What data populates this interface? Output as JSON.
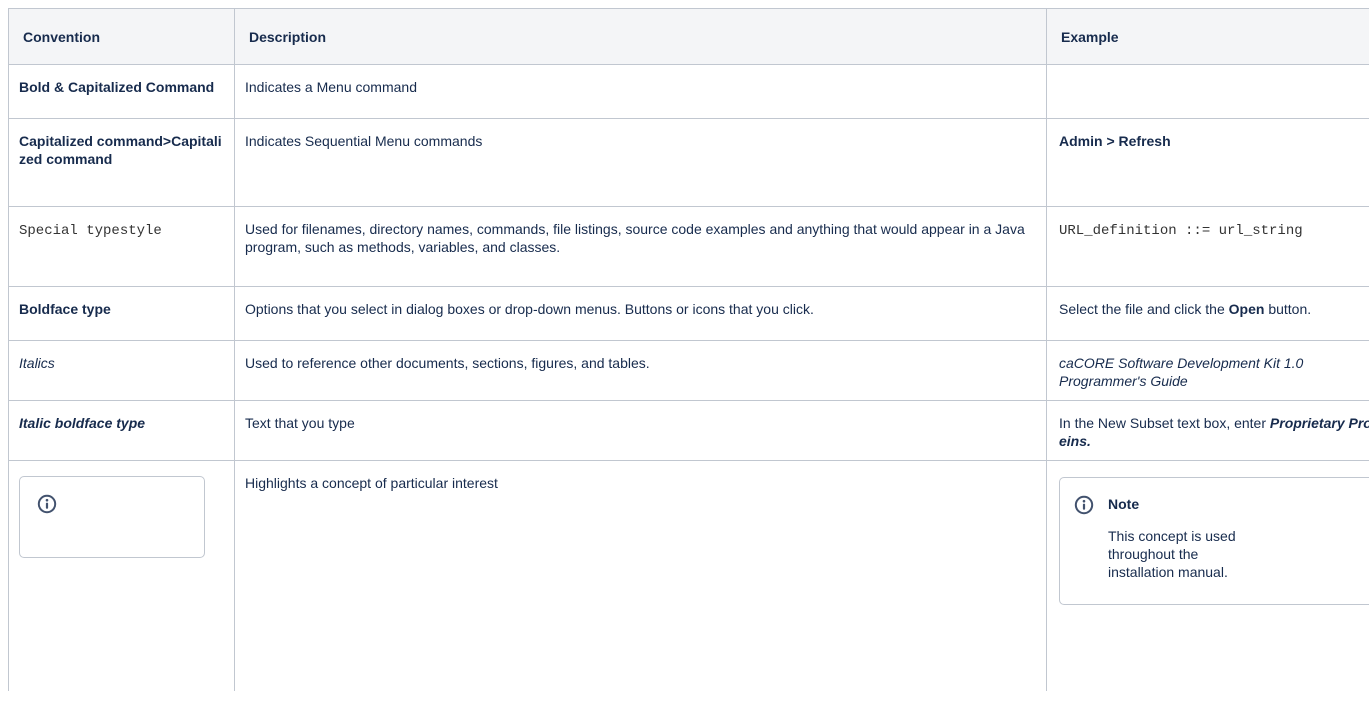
{
  "headers": {
    "convention": "Convention",
    "description": "Description",
    "example": "Example"
  },
  "rows": [
    {
      "convention": "Bold & Capitalized Command",
      "description": "Indicates a Menu command",
      "example": ""
    },
    {
      "convention": "Capitalized command>Capitalized command",
      "description": "Indicates Sequential Menu commands",
      "example": "Admin > Refresh"
    },
    {
      "convention": "Special typestyle",
      "description": "Used for filenames, directory names, commands, file listings, source code examples and anything that would appear in a Java program, such as methods, variables, and classes.",
      "example": "URL_definition ::= url_string"
    },
    {
      "convention": "Boldface type",
      "description": "Options that you select in dialog boxes or drop-down menus. Buttons or icons that you click.",
      "example_pre": "Select the file and click the ",
      "example_bold": "Open",
      "example_post": " button."
    },
    {
      "convention": "Italics",
      "description": "Used to reference other documents, sections, figures, and tables.",
      "example": "caCORE Software Development Kit 1.0 Programmer's Guide"
    },
    {
      "convention": "Italic boldface type",
      "description": "Text that you type",
      "example_pre": "In the New Subset text box, enter ",
      "example_bold": "Proprietary Proteins."
    },
    {
      "convention_icon": "info-icon",
      "description": "Highlights a concept of particular interest",
      "note_icon": "info-icon",
      "note_title": "Note",
      "note_body": "This concept is used throughout the installation manual."
    }
  ],
  "colors": {
    "header_bg": "#f4f5f7",
    "border": "#c1c7d0",
    "text": "#172b4d",
    "icon": "#42526e"
  }
}
